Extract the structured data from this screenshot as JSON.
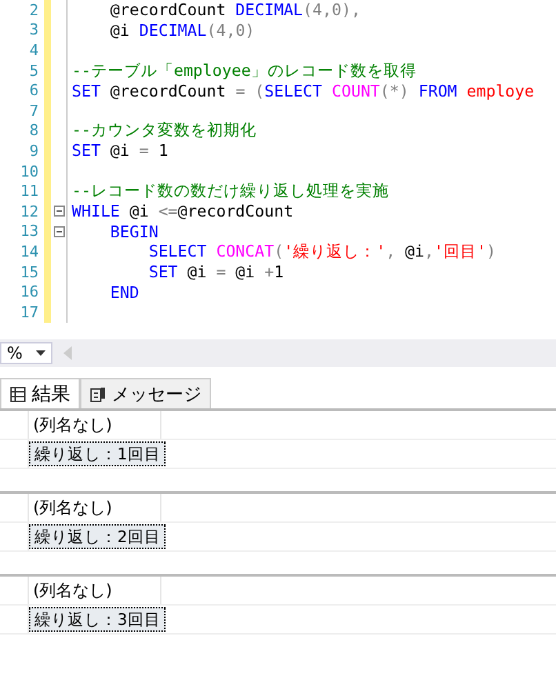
{
  "editor": {
    "lines": [
      {
        "number": "2",
        "fold": false,
        "tokens": [
          {
            "kind": "plain",
            "text": "    @recordCount "
          },
          {
            "kind": "keyword",
            "text": "DECIMAL"
          },
          {
            "kind": "operator",
            "text": "(4,0),"
          }
        ]
      },
      {
        "number": "3",
        "fold": false,
        "tokens": [
          {
            "kind": "plain",
            "text": "    @i "
          },
          {
            "kind": "keyword",
            "text": "DECIMAL"
          },
          {
            "kind": "operator",
            "text": "(4,0)"
          }
        ]
      },
      {
        "number": "4",
        "fold": false
      },
      {
        "number": "5",
        "fold": false,
        "tokens": [
          {
            "kind": "comment",
            "text": "--テーブル「employee」のレコード数を取得"
          }
        ]
      },
      {
        "number": "6",
        "fold": false,
        "tokens": [
          {
            "kind": "keyword",
            "text": "SET"
          },
          {
            "kind": "plain",
            "text": " @recordCount "
          },
          {
            "kind": "operator",
            "text": "= ("
          },
          {
            "kind": "keyword",
            "text": "SELECT"
          },
          {
            "kind": "function",
            "text": " COUNT"
          },
          {
            "kind": "operator",
            "text": "(*)"
          },
          {
            "kind": "keyword",
            "text": " FROM"
          },
          {
            "kind": "string",
            "text": " employe"
          }
        ]
      },
      {
        "number": "7",
        "fold": false
      },
      {
        "number": "8",
        "fold": false,
        "tokens": [
          {
            "kind": "comment",
            "text": "--カウンタ変数を初期化"
          }
        ]
      },
      {
        "number": "9",
        "fold": false,
        "tokens": [
          {
            "kind": "keyword",
            "text": "SET"
          },
          {
            "kind": "plain",
            "text": " @i "
          },
          {
            "kind": "operator",
            "text": "="
          },
          {
            "kind": "plain",
            "text": " 1"
          }
        ]
      },
      {
        "number": "10",
        "fold": false
      },
      {
        "number": "11",
        "fold": false,
        "tokens": [
          {
            "kind": "comment",
            "text": "--レコード数の数だけ繰り返し処理を実施"
          }
        ]
      },
      {
        "number": "12",
        "fold": true,
        "tokens": [
          {
            "kind": "keyword",
            "text": "WHILE"
          },
          {
            "kind": "plain",
            "text": " @i "
          },
          {
            "kind": "operator",
            "text": "<="
          },
          {
            "kind": "plain",
            "text": "@recordCount"
          }
        ]
      },
      {
        "number": "13",
        "fold": true,
        "tokens": [
          {
            "kind": "keyword",
            "text": "    BEGIN"
          }
        ]
      },
      {
        "number": "14",
        "fold": false,
        "tokens": [
          {
            "kind": "keyword",
            "text": "        SELECT"
          },
          {
            "kind": "function",
            "text": " CONCAT"
          },
          {
            "kind": "operator",
            "text": "("
          },
          {
            "kind": "string",
            "text": "'繰り返し：'"
          },
          {
            "kind": "operator",
            "text": ","
          },
          {
            "kind": "plain",
            "text": " @i"
          },
          {
            "kind": "operator",
            "text": ","
          },
          {
            "kind": "string",
            "text": "'回目'"
          },
          {
            "kind": "operator",
            "text": ")"
          }
        ]
      },
      {
        "number": "15",
        "fold": false,
        "tokens": [
          {
            "kind": "keyword",
            "text": "        SET"
          },
          {
            "kind": "plain",
            "text": " @i "
          },
          {
            "kind": "operator",
            "text": "="
          },
          {
            "kind": "plain",
            "text": " @i "
          },
          {
            "kind": "operator",
            "text": "+"
          },
          {
            "kind": "plain",
            "text": "1"
          }
        ]
      },
      {
        "number": "16",
        "fold": false,
        "tokens": [
          {
            "kind": "keyword",
            "text": "    END"
          }
        ]
      },
      {
        "number": "17",
        "fold": false
      }
    ]
  },
  "zoom": {
    "value": "%"
  },
  "tabs": [
    {
      "label": "結果",
      "selected": true
    },
    {
      "label": "メッセージ",
      "selected": false
    }
  ],
  "results": [
    {
      "column": "(列名なし)",
      "value": "繰り返し：1回目"
    },
    {
      "column": "(列名なし)",
      "value": "繰り返し：2回目"
    },
    {
      "column": "(列名なし)",
      "value": "繰り返し：3回目"
    }
  ]
}
